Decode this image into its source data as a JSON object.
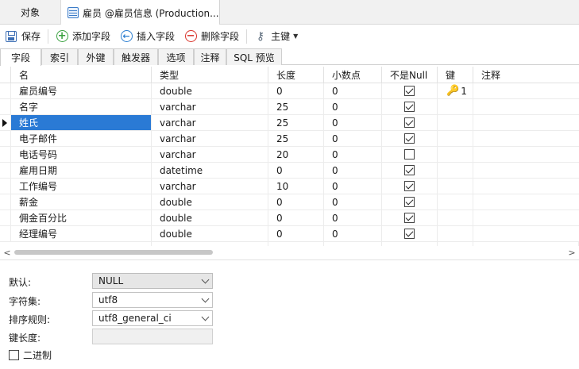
{
  "doc_tabs": [
    {
      "label": "对象"
    },
    {
      "label": "雇员 @雇员信息 (Production..."
    }
  ],
  "toolbar": {
    "save": "保存",
    "add_field": "添加字段",
    "insert_field": "插入字段",
    "delete_field": "删除字段",
    "primary_key": "主键"
  },
  "sub_tabs": [
    "字段",
    "索引",
    "外键",
    "触发器",
    "选项",
    "注释",
    "SQL 预览"
  ],
  "grid": {
    "columns": [
      "名",
      "类型",
      "长度",
      "小数点",
      "不是Null",
      "键",
      "注释"
    ],
    "rows": [
      {
        "name": "雇员编号",
        "type": "double",
        "length": "0",
        "decimals": "0",
        "not_null": true,
        "key": "1"
      },
      {
        "name": "名字",
        "type": "varchar",
        "length": "25",
        "decimals": "0",
        "not_null": true,
        "key": ""
      },
      {
        "name": "姓氏",
        "type": "varchar",
        "length": "25",
        "decimals": "0",
        "not_null": true,
        "key": ""
      },
      {
        "name": "电子邮件",
        "type": "varchar",
        "length": "25",
        "decimals": "0",
        "not_null": true,
        "key": ""
      },
      {
        "name": "电话号码",
        "type": "varchar",
        "length": "20",
        "decimals": "0",
        "not_null": false,
        "key": ""
      },
      {
        "name": "雇用日期",
        "type": "datetime",
        "length": "0",
        "decimals": "0",
        "not_null": true,
        "key": ""
      },
      {
        "name": "工作编号",
        "type": "varchar",
        "length": "10",
        "decimals": "0",
        "not_null": true,
        "key": ""
      },
      {
        "name": "薪金",
        "type": "double",
        "length": "0",
        "decimals": "0",
        "not_null": true,
        "key": ""
      },
      {
        "name": "佣金百分比",
        "type": "double",
        "length": "0",
        "decimals": "0",
        "not_null": true,
        "key": ""
      },
      {
        "name": "经理编号",
        "type": "double",
        "length": "0",
        "decimals": "0",
        "not_null": true,
        "key": ""
      }
    ],
    "selected_row": 2
  },
  "properties": {
    "default_label": "默认:",
    "default_value": "NULL",
    "charset_label": "字符集:",
    "charset_value": "utf8",
    "collation_label": "排序规则:",
    "collation_value": "utf8_general_ci",
    "key_length_label": "键长度:",
    "key_length_value": "",
    "binary_label": "二进制",
    "binary_checked": false
  },
  "colors": {
    "selection": "#2a7ad5",
    "key_icon": "#e0a21a",
    "add_icon": "#3aa240",
    "insert_icon": "#2d7fd1",
    "delete_icon": "#d9342b"
  },
  "icons": {
    "save": "save-icon",
    "add": "add-circle-icon",
    "insert": "insert-circle-icon",
    "delete": "delete-circle-icon",
    "primary_key": "key-icon",
    "table": "table-icon"
  }
}
